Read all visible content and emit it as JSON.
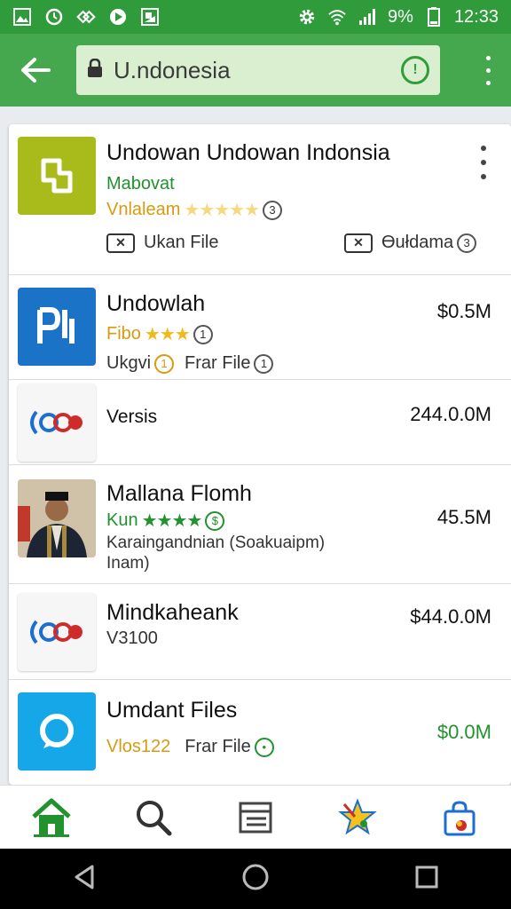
{
  "status_bar": {
    "battery": "9%",
    "time": "12:33"
  },
  "search": {
    "query": "U.ndonesia"
  },
  "items": [
    {
      "title": "Undowan Undowan Indonsia",
      "line1": "Mabovat",
      "line2_prefix": "Vnlaleam",
      "line2_stars": "★★★★★",
      "line2_count": "3",
      "action_left": "Ukan File",
      "action_right": "Ɵułdama",
      "action_right_count": "3"
    },
    {
      "title": "Undowlah",
      "price": "$0.5M",
      "line1_prefix": "Fibo",
      "line1_stars": "★★★",
      "line1_count": "1",
      "line2_prefix": "Ukgvi",
      "line2_count": "1",
      "line2_text": "Frar File",
      "line2_count2": "1"
    },
    {
      "title": "Versis",
      "price": "244.0.0M"
    },
    {
      "title": "Mallana Flomh",
      "price": "45.5M",
      "line1_prefix": "Kun",
      "line1_stars": "★★★★",
      "line1_badge": "$",
      "line2": "Karaingandnian (Soakuaipm)",
      "line3": "Inam)"
    },
    {
      "title": "Mindkaheank",
      "price": "$44.0.0M",
      "line1": "V3100"
    },
    {
      "title": "Umdant Files",
      "price": "$0.0M",
      "line1_prefix": "Vlos122",
      "line1_text": "Frar File"
    }
  ],
  "colors": {
    "primary": "#45a84e",
    "status": "#2f9b3a",
    "accent_green": "#22922e",
    "star": "#f0b91e"
  }
}
